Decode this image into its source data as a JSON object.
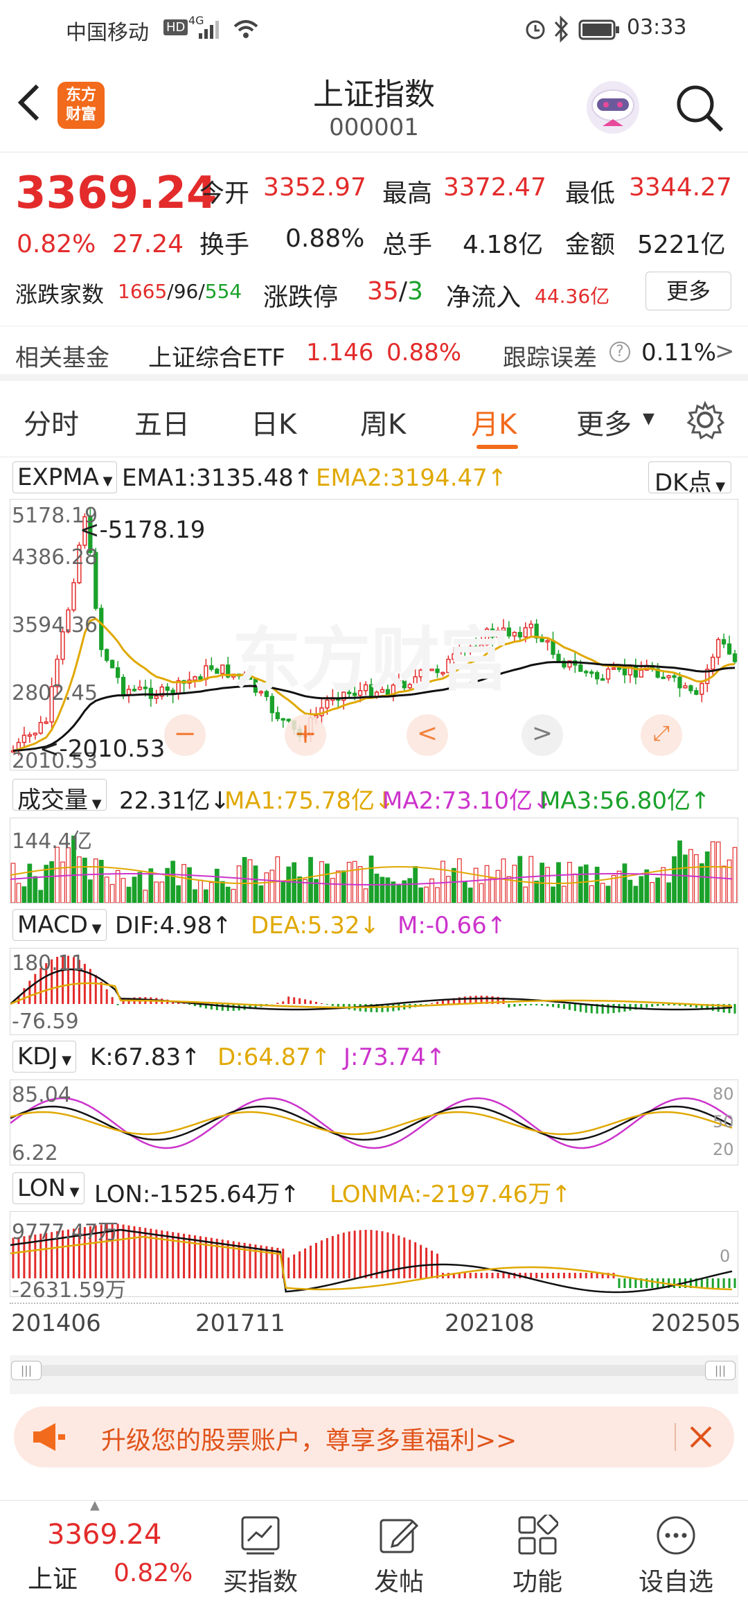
{
  "status": {
    "carrier": "中国移动",
    "net": "4G",
    "time": "03:33"
  },
  "header": {
    "logo": "东方\n财富",
    "title": "上证指数",
    "code": "000001"
  },
  "quote": {
    "price": "3369.24",
    "pct": "0.82%",
    "chg": "27.24",
    "open_label": "今开",
    "open": "3352.97",
    "high_label": "最高",
    "high": "3372.47",
    "low_label": "最低",
    "low": "3344.27",
    "turnover_label": "换手",
    "turnover": "0.88%",
    "vol_label": "总手",
    "vol": "4.18亿",
    "amount_label": "金额",
    "amount": "5221亿",
    "adv_label": "涨跌家数",
    "adv_up": "1665",
    "adv_flat": "/96/",
    "adv_down": "554",
    "limit_label": "涨跌停",
    "limit_up": "35",
    "limit_sep": "/",
    "limit_down": "3",
    "flow_label": "净流入",
    "flow": "44.36亿",
    "more_label": "更多"
  },
  "fund": {
    "label": "相关基金",
    "name": "上证综合ETF",
    "price": "1.146",
    "pct": "0.88%",
    "err_label": "跟踪误差",
    "err": "0.11%"
  },
  "tabs": [
    {
      "label": "分时"
    },
    {
      "label": "五日"
    },
    {
      "label": "日K"
    },
    {
      "label": "周K"
    },
    {
      "label": "月K"
    },
    {
      "label": "更多"
    }
  ],
  "main_chart": {
    "selector": "EXPMA",
    "ema1": "EMA1:3135.48↑",
    "ema2": "EMA2:3194.47↑",
    "dk": "DK点",
    "y_labels": [
      "5178.19",
      "4386.28",
      "3594.36",
      "2802.45",
      "2010.53"
    ],
    "max_annot": "<-5178.19",
    "min_annot": "<-2010.53",
    "watermark": "东方财富"
  },
  "vol_chart": {
    "selector": "成交量",
    "val": "22.31亿↓",
    "ma1": "MA1:75.78亿↓",
    "ma2": "MA2:73.10亿↓",
    "ma3": "MA3:56.80亿↑",
    "ymax": "144.4亿"
  },
  "macd_chart": {
    "selector": "MACD",
    "dif": "DIF:4.98↑",
    "dea": "DEA:5.32↓",
    "m": "M:-0.66↑",
    "ymax": "180.11",
    "ymin": "-76.59"
  },
  "kdj_chart": {
    "selector": "KDJ",
    "k": "K:67.83↑",
    "d": "D:64.87↑",
    "j": "J:73.74↑",
    "ymax": "85.04",
    "ymin": "6.22",
    "r80": "80",
    "r50": "50",
    "r20": "20"
  },
  "lon_chart": {
    "selector": "LON",
    "lon": "LON:-1525.64万↑",
    "lonma": "LONMA:-2197.46万↑",
    "ymax": "9777.47万",
    "ymin": "-2631.59万",
    "r0": "0"
  },
  "x_axis": [
    "201406",
    "201711",
    "202108",
    "202505"
  ],
  "promo": {
    "text": "升级您的股票账户，尊享多重福利>>"
  },
  "bottom": {
    "price": "3369.24",
    "name": "上证",
    "pct": "0.82%",
    "items": [
      "买指数",
      "发帖",
      "功能",
      "设自选"
    ]
  },
  "colors": {
    "up": "#e32b2b",
    "down": "#1aa12a",
    "accent": "#f26a1b",
    "gold": "#e0a800",
    "magenta": "#cc33cc"
  }
}
